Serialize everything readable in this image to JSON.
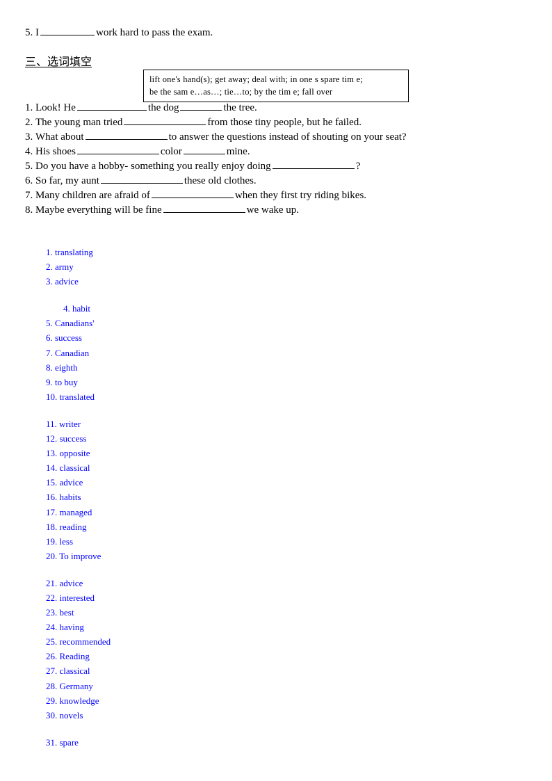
{
  "carry_over": {
    "prefix": "5. I",
    "suffix": "work hard to pass the exam."
  },
  "section": {
    "heading": "三、选词填空"
  },
  "word_bank": {
    "line1": "lift one's hand(s);   get away;   deal with;   in one s spare tim e;",
    "line2": "be the sam e…as…;   tie…to;   by the tim e;   fall over"
  },
  "questions": [
    {
      "number": "1.",
      "parts": [
        "Look! He",
        "the dog",
        "the tree."
      ]
    },
    {
      "number": "2.",
      "parts": [
        "The young man tried",
        "from those tiny people, but he failed."
      ]
    },
    {
      "number": "3.",
      "parts": [
        "What about",
        "to answer the questions instead of shouting on your seat?"
      ]
    },
    {
      "number": "4.",
      "parts": [
        "His shoes",
        "color",
        "mine."
      ]
    },
    {
      "number": "5.",
      "parts": [
        "Do you have a hobby- something you really enjoy doing",
        "?"
      ]
    },
    {
      "number": "6.",
      "parts": [
        "So far, my aunt",
        "these old clothes."
      ]
    },
    {
      "number": "7.",
      "parts": [
        "Many children are afraid of",
        "when they first try riding bikes."
      ]
    },
    {
      "number": "8.",
      "parts": [
        "Maybe everything will be fine",
        "we wake up."
      ]
    }
  ],
  "answers": {
    "color": "#0000FF",
    "groups": [
      {
        "items": [
          "1. translating",
          "2. army",
          "3. advice"
        ]
      },
      {
        "indented_first": true,
        "items": [
          "4. habit",
          "5. Canadians'",
          "6. success",
          "7. Canadian",
          "8. eighth",
          "9. to buy",
          "10. translated"
        ]
      },
      {
        "items": [
          "11. writer",
          "12. success",
          "13. opposite",
          "14. classical",
          "15. advice",
          "16. habits",
          "17. managed",
          "18. reading",
          "19. less",
          "20. To improve"
        ]
      },
      {
        "items": [
          "21. advice",
          "22. interested",
          "23. best",
          "24. having",
          "25. recommended",
          "26. Reading",
          "27. classical",
          "28. Germany",
          "29. knowledge",
          "30. novels"
        ]
      },
      {
        "items": [
          "31. spare"
        ]
      }
    ]
  }
}
